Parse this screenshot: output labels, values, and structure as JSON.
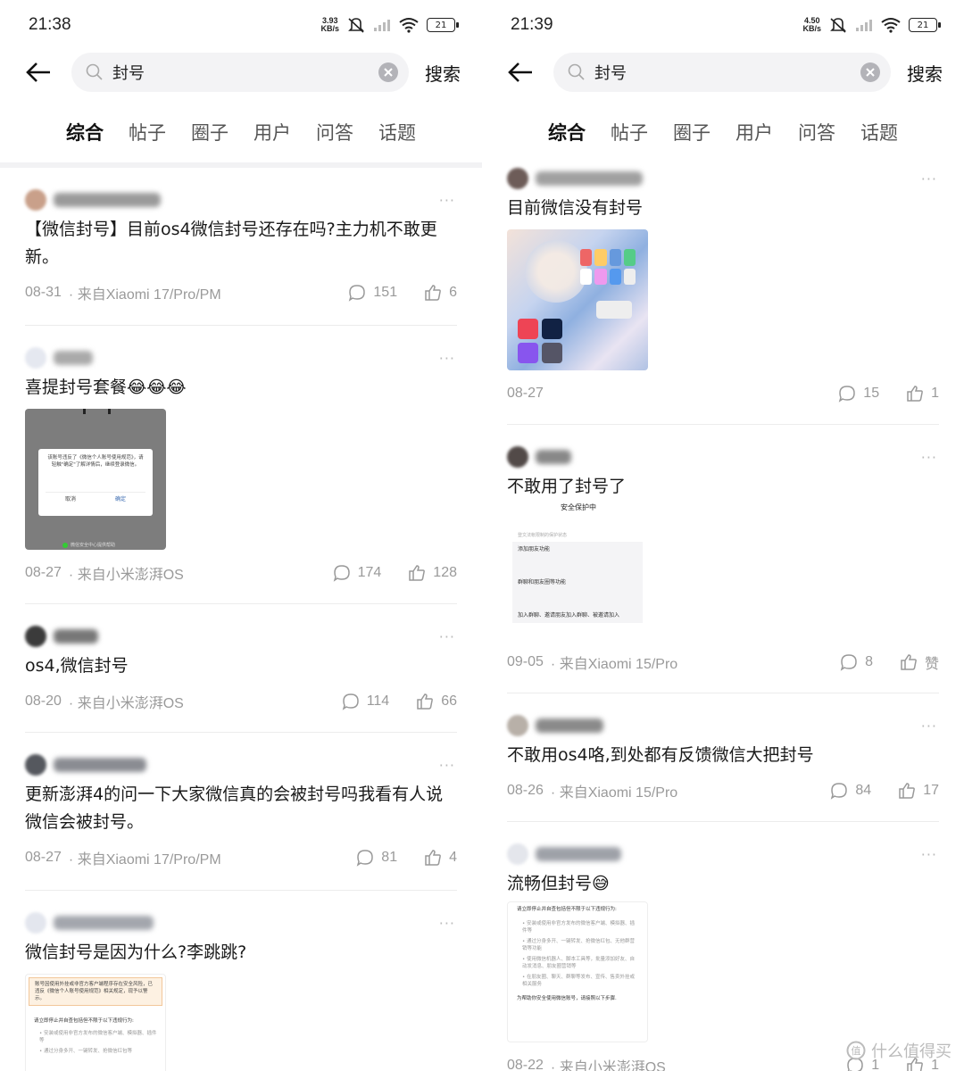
{
  "left": {
    "status": {
      "time": "21:38",
      "speed_value": "3.93",
      "speed_unit": "KB/s",
      "battery": "21"
    },
    "search": {
      "query": "封号",
      "button": "搜索"
    },
    "tabs": [
      {
        "label": "综合"
      },
      {
        "label": "帖子"
      },
      {
        "label": "圈子"
      },
      {
        "label": "用户"
      },
      {
        "label": "问答"
      },
      {
        "label": "话题"
      }
    ],
    "posts": [
      {
        "title": "【微信封号】目前os4微信封号还存在吗?主力机不敢更新。",
        "date": "08-31",
        "source": "来自Xiaomi 17/Pro/PM",
        "comments": "151",
        "likes": "6"
      },
      {
        "title": "喜提封号套餐😂😂😂",
        "date": "08-27",
        "source": "来自小米澎湃OS",
        "comments": "174",
        "likes": "128",
        "image": {
          "dialog_text": "该账号违反了《微信个人账号使用规范》，请轻触\"确定\"了解详情后，继续登录微信。",
          "cancel": "取消",
          "confirm": "确定",
          "footer": "微信安全中心提供帮助"
        }
      },
      {
        "title": "os4,微信封号",
        "date": "08-20",
        "source": "来自小米澎湃OS",
        "comments": "114",
        "likes": "66"
      },
      {
        "title": "更新澎湃4的问一下大家微信真的会被封号吗我看有人说微信会被封号。",
        "date": "08-27",
        "source": "来自Xiaomi 17/Pro/PM",
        "comments": "81",
        "likes": "4"
      },
      {
        "title": "微信封号是因为什么?李跳跳?",
        "image": {
          "notice": "账号因使用外挂或非官方客户端程序存在安全风险，已违反《微信个人账号使用规范》相关规定，现予以警示。",
          "body_title": "请立即停止并自查包括但不限于以下违规行为:",
          "item1": "安装或使用非官方发布的微信客户端、模拟器、插件等",
          "item2": "通过分身多开、一键转发、抢微信红包等"
        }
      }
    ]
  },
  "right": {
    "status": {
      "time": "21:39",
      "speed_value": "4.50",
      "speed_unit": "KB/s",
      "battery": "21"
    },
    "search": {
      "query": "封号",
      "button": "搜索"
    },
    "tabs": [
      {
        "label": "综合"
      },
      {
        "label": "帖子"
      },
      {
        "label": "圈子"
      },
      {
        "label": "用户"
      },
      {
        "label": "问答"
      },
      {
        "label": "话题"
      }
    ],
    "posts": [
      {
        "title": "目前微信没有封号",
        "date": "08-27",
        "comments": "15",
        "likes": "1"
      },
      {
        "title": "不敢用了封号了",
        "date": "09-05",
        "source": "来自Xiaomi 15/Pro",
        "comments": "8",
        "likes": "赞",
        "image": {
          "header": "安全保护中",
          "subheader": "登文法帐限制的保护状态",
          "item1": "添加朋友功能",
          "item2": "群聊和朋友圈等功能",
          "item3": "加入群聊、邀请朋友加入群聊、被邀请加入"
        }
      },
      {
        "title": "不敢用os4咯,到处都有反馈微信大把封号",
        "date": "08-26",
        "source": "来自Xiaomi 15/Pro",
        "comments": "84",
        "likes": "17"
      },
      {
        "title": "流畅但封号😅",
        "date": "08-22",
        "source": "来自小米澎湃OS",
        "comments": "1",
        "likes": "1",
        "image": {
          "body_title": "请立即停止并自查包括但不限于以下违规行为:",
          "item1": "安装或使用非官方发布的微信客户端、模拟器、插件等",
          "item2": "通过分身多开、一键转发、抢微信红包、无他群营销等功能",
          "item3": "使用微信机器人、脚本工具等，批量添加好友、自动发消息、朋友圈营销等",
          "item4": "在朋友圈、聊天、群聊等发布、宣传、售卖外挂或相关服务",
          "footer": "为帮助你安全使用微信账号，请接照以下步骤."
        }
      }
    ]
  },
  "watermark": {
    "text": "什么值得买"
  },
  "colors": {
    "accent": "#111111",
    "meta": "#9a9a9a",
    "search_bg": "#f3f3f5",
    "divider": "#ececec"
  }
}
